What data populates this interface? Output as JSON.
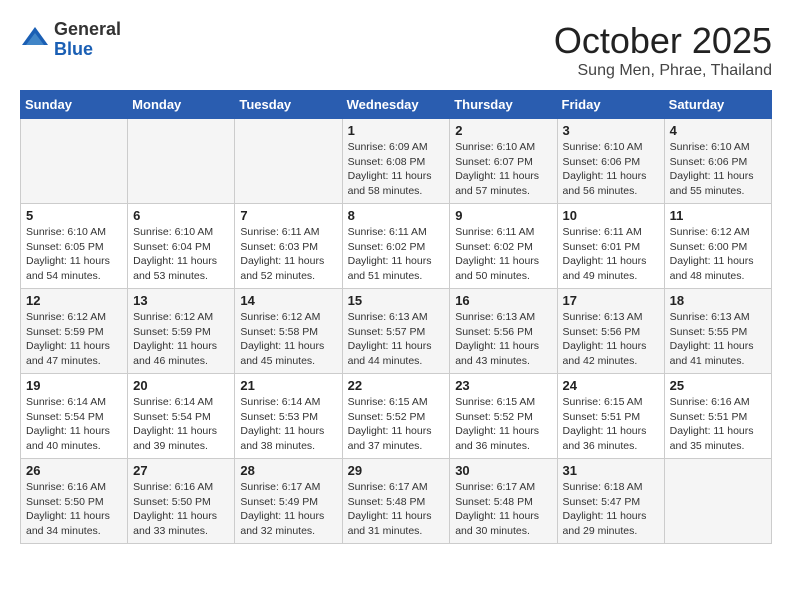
{
  "header": {
    "logo_general": "General",
    "logo_blue": "Blue",
    "month_title": "October 2025",
    "subtitle": "Sung Men, Phrae, Thailand"
  },
  "calendar": {
    "weekdays": [
      "Sunday",
      "Monday",
      "Tuesday",
      "Wednesday",
      "Thursday",
      "Friday",
      "Saturday"
    ],
    "weeks": [
      [
        {
          "day": "",
          "info": ""
        },
        {
          "day": "",
          "info": ""
        },
        {
          "day": "",
          "info": ""
        },
        {
          "day": "1",
          "info": "Sunrise: 6:09 AM\nSunset: 6:08 PM\nDaylight: 11 hours\nand 58 minutes."
        },
        {
          "day": "2",
          "info": "Sunrise: 6:10 AM\nSunset: 6:07 PM\nDaylight: 11 hours\nand 57 minutes."
        },
        {
          "day": "3",
          "info": "Sunrise: 6:10 AM\nSunset: 6:06 PM\nDaylight: 11 hours\nand 56 minutes."
        },
        {
          "day": "4",
          "info": "Sunrise: 6:10 AM\nSunset: 6:06 PM\nDaylight: 11 hours\nand 55 minutes."
        }
      ],
      [
        {
          "day": "5",
          "info": "Sunrise: 6:10 AM\nSunset: 6:05 PM\nDaylight: 11 hours\nand 54 minutes."
        },
        {
          "day": "6",
          "info": "Sunrise: 6:10 AM\nSunset: 6:04 PM\nDaylight: 11 hours\nand 53 minutes."
        },
        {
          "day": "7",
          "info": "Sunrise: 6:11 AM\nSunset: 6:03 PM\nDaylight: 11 hours\nand 52 minutes."
        },
        {
          "day": "8",
          "info": "Sunrise: 6:11 AM\nSunset: 6:02 PM\nDaylight: 11 hours\nand 51 minutes."
        },
        {
          "day": "9",
          "info": "Sunrise: 6:11 AM\nSunset: 6:02 PM\nDaylight: 11 hours\nand 50 minutes."
        },
        {
          "day": "10",
          "info": "Sunrise: 6:11 AM\nSunset: 6:01 PM\nDaylight: 11 hours\nand 49 minutes."
        },
        {
          "day": "11",
          "info": "Sunrise: 6:12 AM\nSunset: 6:00 PM\nDaylight: 11 hours\nand 48 minutes."
        }
      ],
      [
        {
          "day": "12",
          "info": "Sunrise: 6:12 AM\nSunset: 5:59 PM\nDaylight: 11 hours\nand 47 minutes."
        },
        {
          "day": "13",
          "info": "Sunrise: 6:12 AM\nSunset: 5:59 PM\nDaylight: 11 hours\nand 46 minutes."
        },
        {
          "day": "14",
          "info": "Sunrise: 6:12 AM\nSunset: 5:58 PM\nDaylight: 11 hours\nand 45 minutes."
        },
        {
          "day": "15",
          "info": "Sunrise: 6:13 AM\nSunset: 5:57 PM\nDaylight: 11 hours\nand 44 minutes."
        },
        {
          "day": "16",
          "info": "Sunrise: 6:13 AM\nSunset: 5:56 PM\nDaylight: 11 hours\nand 43 minutes."
        },
        {
          "day": "17",
          "info": "Sunrise: 6:13 AM\nSunset: 5:56 PM\nDaylight: 11 hours\nand 42 minutes."
        },
        {
          "day": "18",
          "info": "Sunrise: 6:13 AM\nSunset: 5:55 PM\nDaylight: 11 hours\nand 41 minutes."
        }
      ],
      [
        {
          "day": "19",
          "info": "Sunrise: 6:14 AM\nSunset: 5:54 PM\nDaylight: 11 hours\nand 40 minutes."
        },
        {
          "day": "20",
          "info": "Sunrise: 6:14 AM\nSunset: 5:54 PM\nDaylight: 11 hours\nand 39 minutes."
        },
        {
          "day": "21",
          "info": "Sunrise: 6:14 AM\nSunset: 5:53 PM\nDaylight: 11 hours\nand 38 minutes."
        },
        {
          "day": "22",
          "info": "Sunrise: 6:15 AM\nSunset: 5:52 PM\nDaylight: 11 hours\nand 37 minutes."
        },
        {
          "day": "23",
          "info": "Sunrise: 6:15 AM\nSunset: 5:52 PM\nDaylight: 11 hours\nand 36 minutes."
        },
        {
          "day": "24",
          "info": "Sunrise: 6:15 AM\nSunset: 5:51 PM\nDaylight: 11 hours\nand 36 minutes."
        },
        {
          "day": "25",
          "info": "Sunrise: 6:16 AM\nSunset: 5:51 PM\nDaylight: 11 hours\nand 35 minutes."
        }
      ],
      [
        {
          "day": "26",
          "info": "Sunrise: 6:16 AM\nSunset: 5:50 PM\nDaylight: 11 hours\nand 34 minutes."
        },
        {
          "day": "27",
          "info": "Sunrise: 6:16 AM\nSunset: 5:50 PM\nDaylight: 11 hours\nand 33 minutes."
        },
        {
          "day": "28",
          "info": "Sunrise: 6:17 AM\nSunset: 5:49 PM\nDaylight: 11 hours\nand 32 minutes."
        },
        {
          "day": "29",
          "info": "Sunrise: 6:17 AM\nSunset: 5:48 PM\nDaylight: 11 hours\nand 31 minutes."
        },
        {
          "day": "30",
          "info": "Sunrise: 6:17 AM\nSunset: 5:48 PM\nDaylight: 11 hours\nand 30 minutes."
        },
        {
          "day": "31",
          "info": "Sunrise: 6:18 AM\nSunset: 5:47 PM\nDaylight: 11 hours\nand 29 minutes."
        },
        {
          "day": "",
          "info": ""
        }
      ]
    ]
  }
}
